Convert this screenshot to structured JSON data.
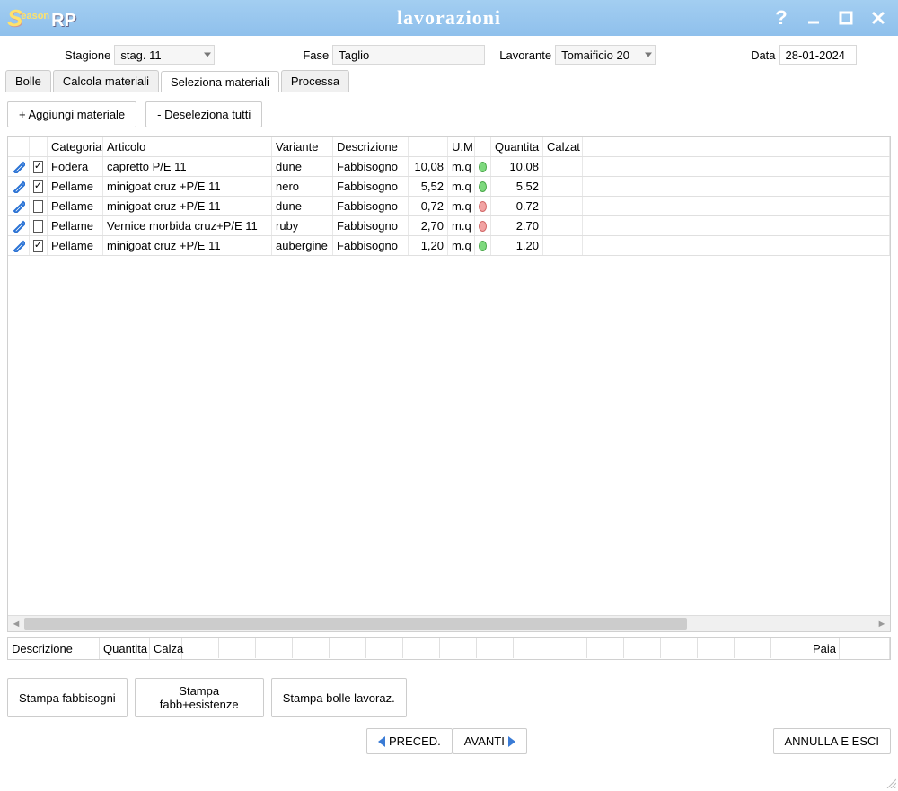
{
  "app_logo": {
    "s": "S",
    "season": "eason",
    "rp": "RP"
  },
  "window_title": "lavorazioni",
  "form": {
    "stagione_label": "Stagione",
    "stagione_value": "stag. 11",
    "fase_label": "Fase",
    "fase_value": "Taglio",
    "lavorante_label": "Lavorante",
    "lavorante_value": "Tomaificio 20",
    "data_label": "Data",
    "data_value": "28-01-2024"
  },
  "tabs": {
    "bolle": "Bolle",
    "calcola": "Calcola materiali",
    "seleziona": "Seleziona materiali",
    "processa": "Processa"
  },
  "actions": {
    "aggiungi": "+ Aggiungi materiale",
    "deseleziona": "- Deseleziona tutti"
  },
  "headers": {
    "categoria": "Categoria",
    "articolo": "Articolo",
    "variante": "Variante",
    "descrizione": "Descrizione",
    "um": "U.M",
    "quantita": "Quantita",
    "calzat": "Calzat"
  },
  "rows": [
    {
      "checked": true,
      "categoria": "Fodera",
      "articolo": "capretto P/E 11",
      "variante": "dune",
      "descrizione": "Fabbisogno",
      "q": "10,08",
      "um": "m.q",
      "dot": "green",
      "qta": "10.08"
    },
    {
      "checked": true,
      "categoria": "Pellame",
      "articolo": "minigoat cruz +P/E 11",
      "variante": "nero",
      "descrizione": "Fabbisogno",
      "q": "5,52",
      "um": "m.q",
      "dot": "green",
      "qta": "5.52"
    },
    {
      "checked": false,
      "categoria": "Pellame",
      "articolo": "minigoat cruz +P/E 11",
      "variante": "dune",
      "descrizione": "Fabbisogno",
      "q": "0,72",
      "um": "m.q",
      "dot": "red",
      "qta": "0.72"
    },
    {
      "checked": false,
      "categoria": "Pellame",
      "articolo": "Vernice morbida cruz+P/E 11",
      "variante": "ruby",
      "descrizione": "Fabbisogno",
      "q": "2,70",
      "um": "m.q",
      "dot": "red",
      "qta": "2.70"
    },
    {
      "checked": true,
      "categoria": "Pellame",
      "articolo": "minigoat cruz +P/E 11",
      "variante": "aubergine",
      "descrizione": "Fabbisogno",
      "q": "1,20",
      "um": "m.q",
      "dot": "green",
      "qta": "1.20"
    }
  ],
  "lower_headers": {
    "descrizione": "Descrizione",
    "quantita": "Quantita",
    "calza": "Calza",
    "paia": "Paia"
  },
  "print_buttons": {
    "fabbisogni": "Stampa fabbisogni",
    "fabb_esistenze": "Stampa fabb+esistenze",
    "bolle": "Stampa bolle lavoraz."
  },
  "nav": {
    "preced": "PRECED.",
    "avanti": "AVANTI",
    "annulla": "ANNULLA E ESCI"
  }
}
